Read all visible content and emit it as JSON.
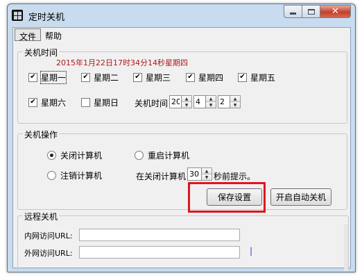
{
  "window": {
    "title": "定时关机"
  },
  "menu": {
    "file": "文件",
    "help": "帮助"
  },
  "shutdown_time": {
    "group_label": "关机时间",
    "current_datetime": "2015年1月22日17时34分14秒星期四",
    "weekdays": [
      {
        "label": "星期一",
        "checked": true
      },
      {
        "label": "星期二",
        "checked": true
      },
      {
        "label": "星期三",
        "checked": true
      },
      {
        "label": "星期四",
        "checked": true
      },
      {
        "label": "星期五",
        "checked": true
      },
      {
        "label": "星期六",
        "checked": true
      },
      {
        "label": "星期日",
        "checked": false
      }
    ],
    "time_label": "关机时间",
    "hour": "20",
    "minute": "4",
    "second": "2"
  },
  "shutdown_action": {
    "group_label": "关机操作",
    "options": [
      {
        "label": "关闭计算机",
        "selected": true
      },
      {
        "label": "重启计算机",
        "selected": false
      },
      {
        "label": "注销计算机",
        "selected": false
      }
    ],
    "prompt_prefix": "在关闭计算机",
    "prompt_seconds": "30",
    "prompt_suffix": "秒前提示。",
    "save_button": "保存设置",
    "auto_button": "开启自动关机"
  },
  "remote": {
    "group_label": "远程关机",
    "intranet_label": "内网访问URL:",
    "internet_label": "外网访问URL:"
  },
  "colors": {
    "datetime_text": "#b0171c",
    "highlight": "#e0141e"
  }
}
